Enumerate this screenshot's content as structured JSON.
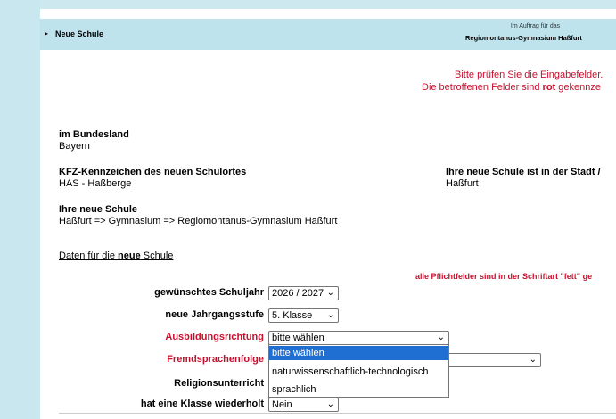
{
  "header": {
    "arrow": "▸",
    "title": "Neue Schule",
    "subtitle": "Im Auftrag für das",
    "school": "Regiomontanus-Gymnasium Haßfurt"
  },
  "warning": {
    "line1": "Bitte prüfen Sie die Eingabefelder.",
    "line2_pre": "Die betroffenen Felder sind ",
    "line2_bold": "rot",
    "line2_post": " gekennze"
  },
  "info": {
    "bundesland_label": "im Bundesland",
    "bundesland_value": "Bayern",
    "kfz_label": "KFZ-Kennzeichen des neuen Schulortes",
    "kfz_value": "HAS - Haßberge",
    "stadt_label": "Ihre neue Schule ist in der Stadt /",
    "stadt_value": "Haßfurt",
    "schule_label": "Ihre neue Schule",
    "schule_value": "Haßfurt => Gymnasium => Regiomontanus-Gymnasium Haßfurt"
  },
  "link": {
    "pre": "Daten für die ",
    "bold": "neue",
    "post": " Schule"
  },
  "pflicht_hint": "alle Pflichtfelder sind in der Schriftart \"fett\" ge",
  "form": {
    "schuljahr_label": "gewünschtes Schuljahr",
    "schuljahr_value": "2026 / 2027",
    "jahrgang_label": "neue Jahrgangsstufe",
    "jahrgang_value": "5. Klasse",
    "ausbildung_label": "Ausbildungsrichtung",
    "ausbildung_value": "bitte wählen",
    "fremdsprachen_label": "Fremdsprachenfolge",
    "religion_label": "Religionsunterricht",
    "wiederholt_label": "hat eine Klasse wiederholt",
    "wiederholt_value": "Nein"
  },
  "dropdown_options": [
    "bitte wählen",
    "naturwissenschaftlich-technologisch",
    "sprachlich"
  ],
  "colors": {
    "header_bg": "#bfe3ec",
    "side_bar": "#c8e7ee",
    "error_red": "#c8102e",
    "selected_option": "#1e6fd1"
  }
}
